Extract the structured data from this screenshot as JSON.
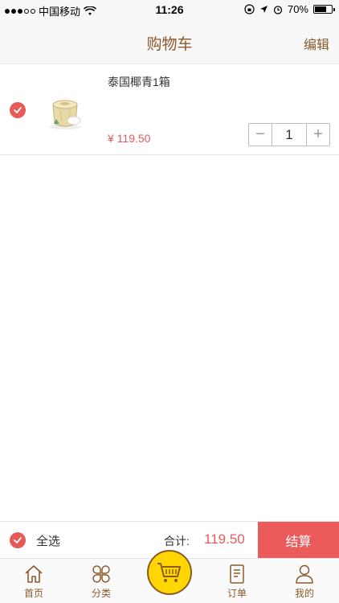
{
  "status_bar": {
    "carrier": "中国移动",
    "time": "11:26",
    "battery": "70%",
    "battery_level": 0.7
  },
  "nav": {
    "title": "购物车",
    "edit_label": "编辑"
  },
  "cart": {
    "items": [
      {
        "name": "泰国椰青1箱",
        "price": "¥ 119.50",
        "quantity": "1",
        "checked": true
      }
    ]
  },
  "stepper": {
    "minus": "−",
    "plus": "+"
  },
  "checkout": {
    "select_all_label": "全选",
    "total_label": "合计:",
    "total_value": "119.50",
    "checkout_button": "结算"
  },
  "tabs": [
    {
      "label": "首页",
      "icon": "home-icon"
    },
    {
      "label": "分类",
      "icon": "category-icon"
    },
    {
      "label": "",
      "icon": "cart-icon"
    },
    {
      "label": "订单",
      "icon": "order-icon"
    },
    {
      "label": "我的",
      "icon": "profile-icon"
    }
  ],
  "colors": {
    "accent_brown": "#8a5a2b",
    "price_red": "#e85a5a",
    "checkout_red": "#ec5b5b",
    "cart_yellow": "#ffd600"
  }
}
